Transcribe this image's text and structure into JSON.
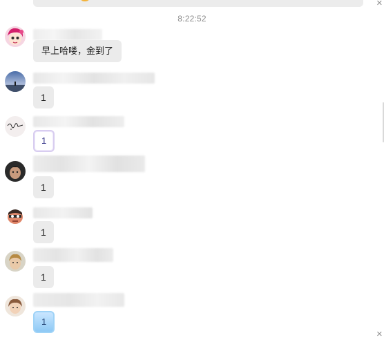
{
  "chat": {
    "timestamp": "8:22:52",
    "messages": [
      {
        "text": "早上哈喽，金到了"
      },
      {
        "text": "1"
      },
      {
        "text": "1"
      },
      {
        "text": "1"
      },
      {
        "text": "1"
      },
      {
        "text": "1"
      },
      {
        "text": "1"
      }
    ]
  },
  "colors": {
    "bubble_bg": "#ebebeb",
    "timestamp": "#8c8c8c"
  },
  "icons": [
    "close-icon"
  ]
}
